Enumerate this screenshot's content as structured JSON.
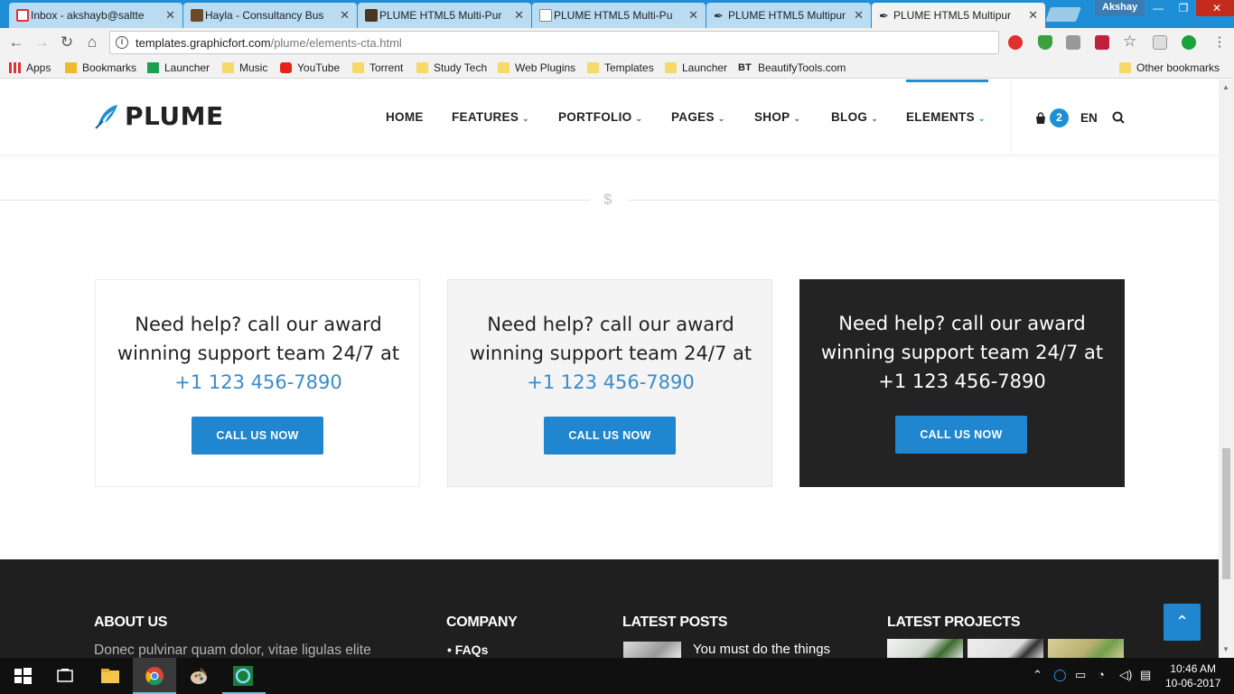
{
  "browser": {
    "tabs": [
      {
        "title": "Inbox - akshayb@saltte",
        "favicon": "gmail-icon"
      },
      {
        "title": "Hayla - Consultancy Bus",
        "favicon": "site-icon"
      },
      {
        "title": "PLUME HTML5 Multi-Pur",
        "favicon": "site-icon"
      },
      {
        "title": "PLUME HTML5 Multi-Pu",
        "favicon": "doc-icon"
      },
      {
        "title": "PLUME HTML5 Multipur",
        "favicon": "plume-icon"
      },
      {
        "title": "PLUME HTML5 Multipur",
        "favicon": "plume-icon",
        "active": true
      }
    ],
    "user": "Akshay",
    "url_host": "templates.graphicfort.com",
    "url_path": "/plume/elements-cta.html",
    "bookmarks": [
      "Apps",
      "Bookmarks",
      "Launcher",
      "Music",
      "YouTube",
      "Torrent",
      "Study Tech",
      "Web Plugins",
      "Templates",
      "Launcher",
      "BeautifyTools.com"
    ],
    "other_bookmarks": "Other bookmarks"
  },
  "site": {
    "logo": "PLUME",
    "nav": [
      "HOME",
      "FEATURES",
      "PORTFOLIO",
      "PAGES",
      "SHOP",
      "BLOG",
      "ELEMENTS"
    ],
    "active_nav": "ELEMENTS",
    "cart_count": "2",
    "language": "EN",
    "accent": "#1e8fd6"
  },
  "divider_icon": "$",
  "cta": [
    {
      "style": "white",
      "line1": "Need help? call our award",
      "line2": "winning support team 24/7 at",
      "phone": "+1 123 456-7890",
      "button": "CALL US NOW"
    },
    {
      "style": "grey",
      "line1": "Need help? call our award",
      "line2": "winning support team 24/7 at",
      "phone": "+1 123 456-7890",
      "button": "CALL US NOW"
    },
    {
      "style": "dark",
      "line1": "Need help? call our award",
      "line2": "winning support team 24/7 at",
      "phone": "+1 123 456-7890",
      "button": "CALL US NOW"
    }
  ],
  "footer": {
    "about_heading": "ABOUT US",
    "about_text": "Donec pulvinar quam dolor, vitae ligulas elite",
    "company_heading": "COMPANY",
    "company_link": "FAQs",
    "posts_heading": "LATEST POSTS",
    "post_title": "You must do the things",
    "projects_heading": "LATEST PROJECTS"
  },
  "taskbar": {
    "time": "10:46 AM",
    "date": "10-06-2017"
  }
}
